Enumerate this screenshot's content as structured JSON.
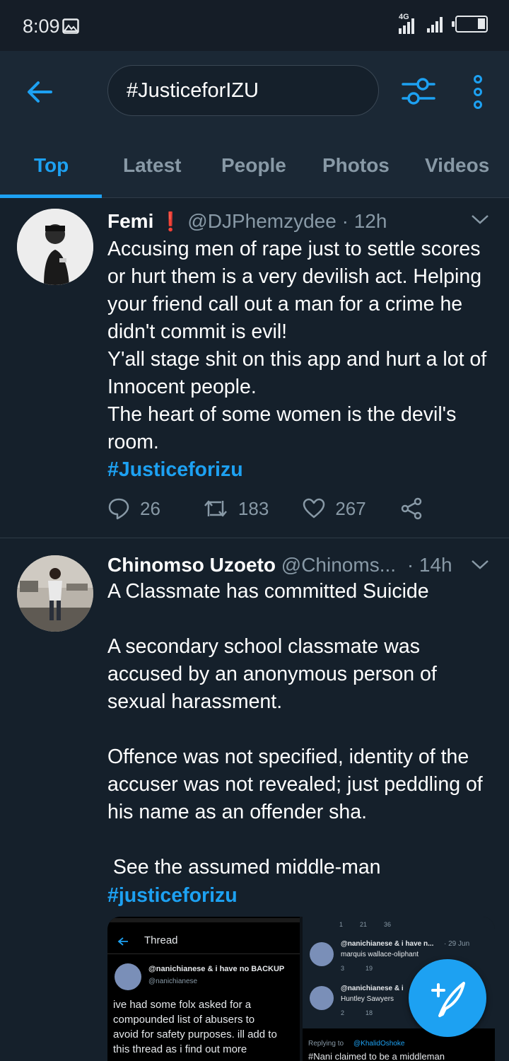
{
  "status_bar": {
    "time": "8:09",
    "network": "4G"
  },
  "search": {
    "query": "#JusticeforIZU"
  },
  "tabs": [
    {
      "label": "Top",
      "active": true
    },
    {
      "label": "Latest",
      "active": false
    },
    {
      "label": "People",
      "active": false
    },
    {
      "label": "Photos",
      "active": false
    },
    {
      "label": "Videos",
      "active": false
    }
  ],
  "colors": {
    "accent": "#1da1f2",
    "background": "#15202b",
    "muted": "#8899a6",
    "badge": "#e0245e"
  },
  "tweets": [
    {
      "name": "Femi",
      "badge": "❗",
      "handle": "@DJPhemzydee",
      "time": "· 12h",
      "text": "Accusing men of rape just to settle scores or hurt them is a very devilish act. Helping your friend call out a man for a crime he didn't commit is evil!\nY'all stage shit on this app and hurt a lot of Innocent people.\nThe heart of some women is the devil's room.",
      "hashtag": "#Justiceforizu",
      "replies": "26",
      "retweets": "183",
      "likes": "267"
    },
    {
      "name": "Chinomso Uzoeto",
      "handle": "@Chinoms...",
      "time": "· 14h",
      "text": "A Classmate has committed Suicide\n\nA secondary school classmate was accused by an anonymous person of sexual harassment.\n\nOffence was not specified, identity of the accuser was not revealed; just peddling of his name as an offender sha.\n\n See the assumed middle-man",
      "hashtag": "#justiceforizu"
    }
  ],
  "embedded": {
    "left": {
      "header": "Thread",
      "user": "@nanichianese & i have no BACKUP",
      "handle": "@nanichianese",
      "text": "ive had some folx asked for a compounded list of abusers to avoid for safety purposes. ill add to this thread as i find out more"
    },
    "right": {
      "top_counts": [
        "1",
        "21",
        "36"
      ],
      "item1_user": "@nanichianese & i have n...",
      "item1_time": "· 29 Jun",
      "item1_text": "marquis wallace-oliphant",
      "item1_counts": [
        "3",
        "19"
      ],
      "item2_user": "@nanichianese & i",
      "item2_text": "Huntley Sawyers",
      "item2_counts": [
        "2",
        "18"
      ],
      "replying": "Replying to",
      "replying_handle": "@KhalidOshoke",
      "bottom_text": "#Nani claimed to be a middleman"
    }
  }
}
